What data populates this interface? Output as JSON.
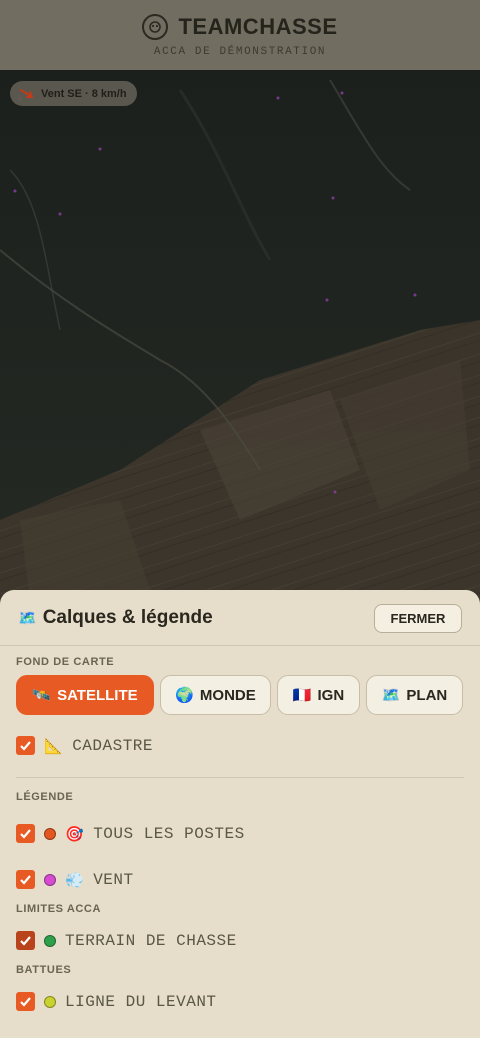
{
  "header": {
    "title": "TEAMCHASSE",
    "subtitle": "ACCA DE DÉMONSTRATION"
  },
  "wind": {
    "label": "Vent SE · 8 km/h"
  },
  "panel": {
    "title_emoji": "🗺️",
    "title": "Calques & légende",
    "close_label": "FERMER",
    "basemap_section": "FOND DE CARTE",
    "basemaps": [
      {
        "emoji": "🛰️",
        "label": "SATELLITE",
        "active": true
      },
      {
        "emoji": "🌍",
        "label": "MONDE",
        "active": false
      },
      {
        "emoji": "🇫🇷",
        "label": "IGN",
        "active": false
      },
      {
        "emoji": "🗺️",
        "label": "PLAN",
        "active": false
      }
    ],
    "cadastre": {
      "emoji": "📐",
      "label": "CADASTRE",
      "checked": true
    },
    "legend_section": "LÉGENDE",
    "legend_items": [
      {
        "emoji": "🎯",
        "label": "TOUS LES POSTES",
        "color": "#e2561f",
        "checked": true
      },
      {
        "emoji": "💨",
        "label": "VENT",
        "color": "#d64bd1",
        "checked": true
      }
    ],
    "limits_section": "LIMITES ACCA",
    "limits_items": [
      {
        "label": "TERRAIN DE CHASSE",
        "color": "#2e9f4a",
        "checked": true
      }
    ],
    "drives_section": "BATTUES",
    "drives_items": [
      {
        "label": "LIGNE DU LEVANT",
        "color": "#c9d22e",
        "checked": true
      }
    ]
  },
  "colors": {
    "accent": "#e85a24",
    "sheet_bg": "#e6ddcb"
  }
}
